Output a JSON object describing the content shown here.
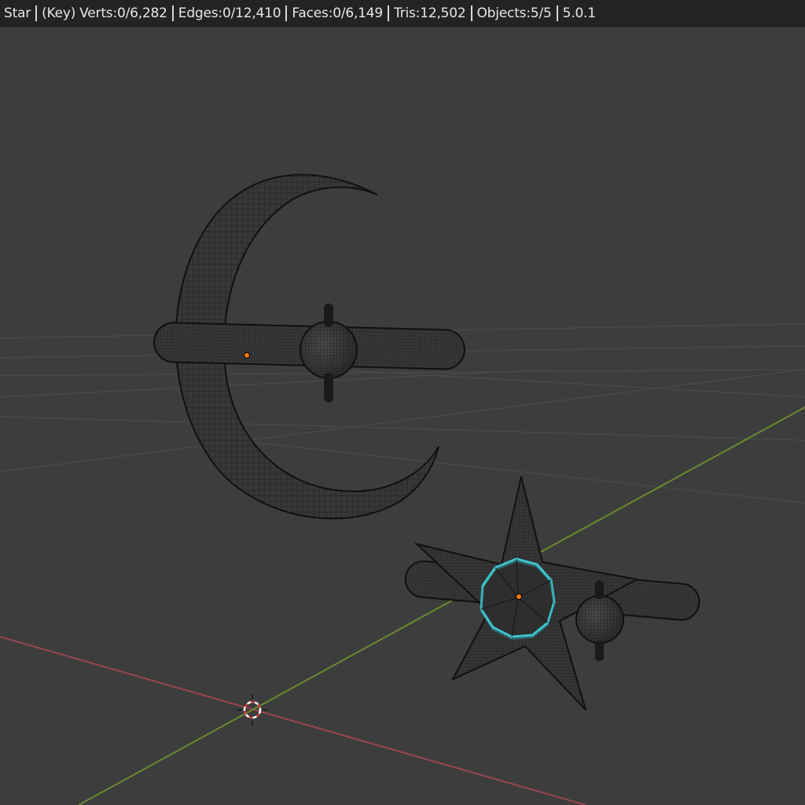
{
  "status_bar": {
    "active_object": "Star",
    "key_label": "(Key)",
    "verts": "Verts:0/6,282",
    "edges": "Edges:0/12,410",
    "faces": "Faces:0/6,149",
    "tris": "Tris:12,502",
    "objects": "Objects:5/5",
    "version": "5.0.1"
  },
  "colors": {
    "viewport_bg": "#3d3d3d",
    "status_bg": "#232323",
    "x_axis": "#9b4652",
    "y_axis": "#6a8a2d",
    "grid": "#4b4b4b",
    "wire": "#141414",
    "selection": "#3ec6d0",
    "origin": "#ff7a1a"
  },
  "icons": {
    "cursor": "3d-cursor-icon",
    "origin": "object-origin-dot-icon"
  }
}
